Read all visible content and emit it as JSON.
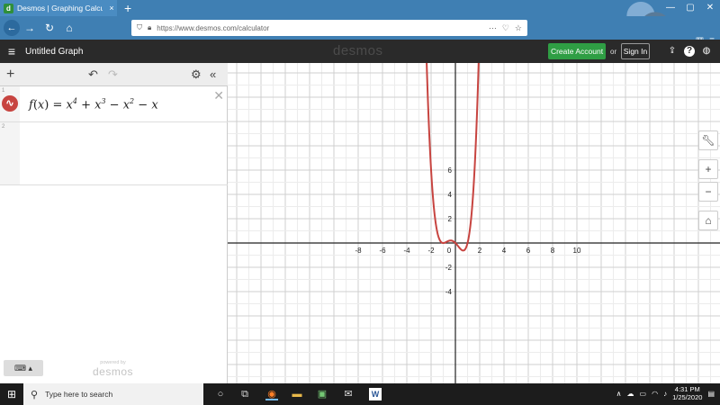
{
  "browser": {
    "tab_title": "Desmos | Graphing Calculator",
    "tab_close": "×",
    "new_tab": "+",
    "url": "https://www.desmos.com/calculator",
    "url_actions": [
      "···",
      "♡",
      "☆"
    ],
    "window_controls": [
      "—",
      "▢",
      "✕"
    ],
    "nav_icons": [
      "back-icon",
      "forward-icon",
      "reload-icon",
      "home-icon"
    ]
  },
  "header": {
    "title": "Untitled Graph",
    "brand": "desmos",
    "create_account": "Create Account",
    "or": "or",
    "sign_in": "Sign In"
  },
  "expressions": {
    "toolbar_icons": [
      "add-icon",
      "undo-icon",
      "redo-icon",
      "settings-icon",
      "collapse-icon"
    ],
    "rows": [
      {
        "number": "1",
        "latex_plain": "f(x) = x^4 + x^3 − x^2 − x",
        "color": "#c74440"
      },
      {
        "number": "2",
        "latex_plain": ""
      }
    ],
    "powered_by": "powered by",
    "powered_logo": "desmos"
  },
  "graph": {
    "x_ticks": [
      "-8",
      "-6",
      "-4",
      "-2",
      "0",
      "2",
      "4",
      "6",
      "8",
      "10"
    ],
    "y_ticks": [
      "6",
      "4",
      "2",
      "-2",
      "-4"
    ],
    "curve_color": "#c74440",
    "side_tools": [
      "wrench-icon",
      "zoom-in-icon",
      "zoom-out-icon",
      "home-view-icon"
    ]
  },
  "taskbar": {
    "search_placeholder": "Type here to search",
    "time": "4:31 PM",
    "date": "1/25/2020"
  }
}
